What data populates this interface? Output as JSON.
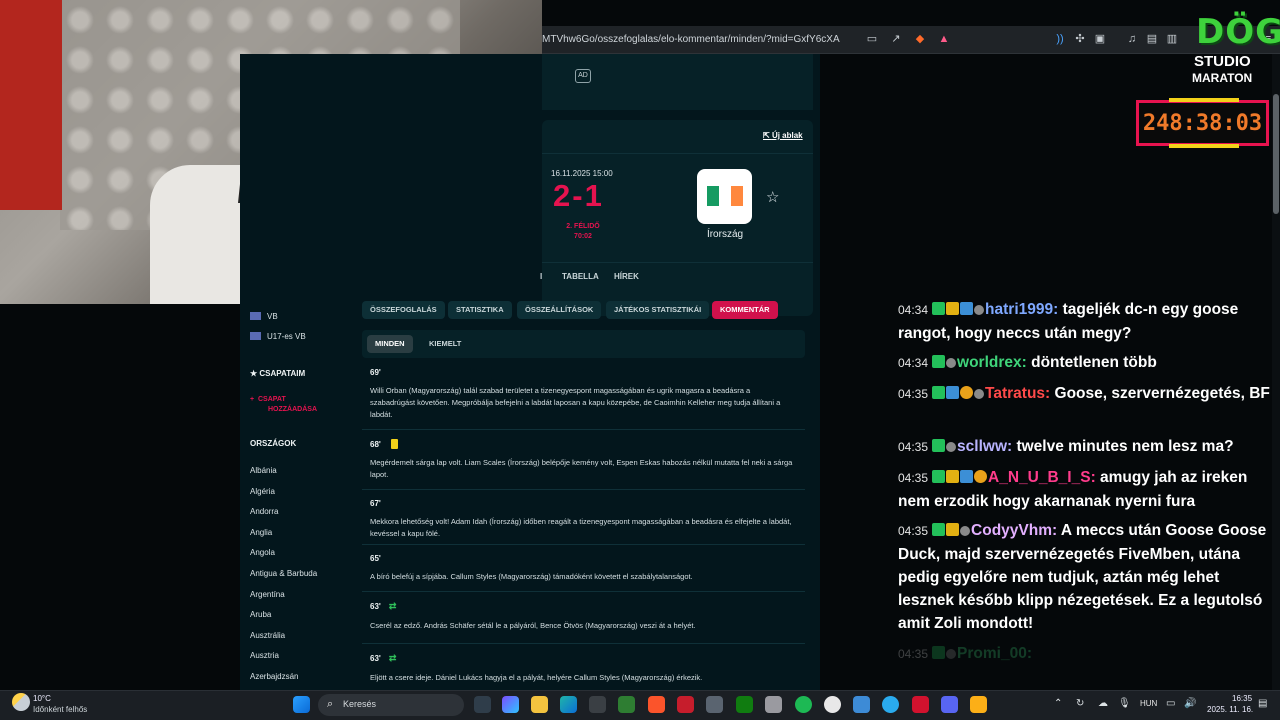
{
  "browser": {
    "url": "MTVhw6Go/osszefoglalas/elo-kommentar/minden/?mid=GxfY6cXA"
  },
  "ad": {
    "label": "AD"
  },
  "match": {
    "new_window": "Új ablak",
    "date": "16.11.2025 15:00",
    "score": "2-1",
    "period": "2. FÉLIDŐ",
    "clock": "70:02",
    "away_team": "Írország",
    "flag_colors": [
      "#169b62",
      "#ffffff",
      "#ff883e"
    ],
    "tabs": [
      "I",
      "TABELLA",
      "HÍREK"
    ]
  },
  "sidebar": {
    "competitions": [
      "VB",
      "U17-es VB"
    ],
    "my_teams": "CSAPATAIM",
    "add_team": [
      "CSAPAT",
      "HOZZÁADÁSA"
    ],
    "countries_header": "ORSZÁGOK",
    "countries": [
      "Albánia",
      "Algéria",
      "Andorra",
      "Anglia",
      "Angola",
      "Antigua & Barbuda",
      "Argentína",
      "Aruba",
      "Ausztrália",
      "Ausztria",
      "Azerbajdzsán"
    ]
  },
  "subtabs": [
    "ÖSSZEFOGLALÁS",
    "STATISZTIKA",
    "ÖSSZEÁLLÍTÁSOK",
    "JÁTÉKOS STATISZTIKÁI",
    "KOMMENTÁR"
  ],
  "filters": [
    "MINDEN",
    "KIEMELT"
  ],
  "events": [
    {
      "minute": "69'",
      "icon": "",
      "text": "Willi Orban (Magyarország) talál szabad területet a tizenegyespont magasságában és ugrik magasra a beadásra a szabadrúgást követően. Megpróbálja befejelni a labdát laposan a kapu közepébe, de Caoimhin Kelleher meg tudja állítani a labdát."
    },
    {
      "minute": "68'",
      "icon": "yellow-card",
      "text": "Megérdemelt sárga lap volt. Liam Scales (Írország) belépője kemény volt, Espen Eskas habozás nélkül mutatta fel neki a sárga lapot."
    },
    {
      "minute": "67'",
      "icon": "",
      "text": "Mekkora lehetőség volt! Adam Idah (Írország) időben reagált a tizenegyespont magasságában a beadásra és elfejelte a labdát, kevéssel a kapu fölé."
    },
    {
      "minute": "65'",
      "icon": "",
      "text": "A bíró belefúj a sípjába. Callum Styles (Magyarország) támadóként követett el szabálytalanságot."
    },
    {
      "minute": "63'",
      "icon": "substitution",
      "text": "Cserél az edző. András Schäfer sétál le a pályáról, Bence Ötvös (Magyarország) veszi át a helyét."
    },
    {
      "minute": "63'",
      "icon": "substitution",
      "text": "Eljött a csere ideje. Dániel Lukács hagyja el a pályát, helyére Callum Styles (Magyarország) érkezik."
    }
  ],
  "chat": [
    {
      "time": "04:34",
      "user": "hatri1999",
      "color": "#7fa8ff",
      "badges": [
        "k",
        "crown",
        "blue",
        "dot"
      ],
      "text": "tageljék dc-n egy goose rangot, hogy neccs után megy?"
    },
    {
      "time": "04:34",
      "user": "worldrex",
      "color": "#3fd47a",
      "badges": [
        "k",
        "dot"
      ],
      "text": "döntetlenen több"
    },
    {
      "time": "04:35",
      "user": "Tatratus",
      "color": "#ff4a4a",
      "badges": [
        "k",
        "blue",
        "coin",
        "dot"
      ],
      "text": "Goose, szervernézegetés, BF"
    },
    {
      "time": "04:35",
      "user": "scllww",
      "color": "#b9b4ff",
      "badges": [
        "k",
        "dot"
      ],
      "text": "twelve minutes nem lesz ma?"
    },
    {
      "time": "04:35",
      "user": "A_N_U_B_I_S",
      "color": "#ff3c8c",
      "badges": [
        "k",
        "crown",
        "blue",
        "coin"
      ],
      "text": "amugy jah az ireken nem erzodik hogy akarnanak nyerni fura"
    },
    {
      "time": "04:35",
      "user": "CodyyVhm",
      "color": "#e3b0ff",
      "badges": [
        "k",
        "crown",
        "dot"
      ],
      "text": "A meccs után Goose Goose Duck, majd szervernézegetés FiveMben, utána pedig egyelőre nem tudjuk, aztán még lehet lesznek később klipp nézegetések. Ez a legutolsó amit Zoli mondott!"
    },
    {
      "time": "04:35",
      "user": "Promi_00",
      "color": "#3fd47a",
      "badges": [
        "k",
        "dot"
      ],
      "text": ""
    }
  ],
  "overlay": {
    "logo_top": "DÖG",
    "logo_mid": "STUDIO",
    "logo_bottom": "MARATON",
    "timer": "248:38:03"
  },
  "taskbar": {
    "temperature": "10°C",
    "weather": "Időnként felhős",
    "search_label": "Keresés",
    "language": "HUN",
    "time": "16:35",
    "date": "2025. 11. 16."
  }
}
